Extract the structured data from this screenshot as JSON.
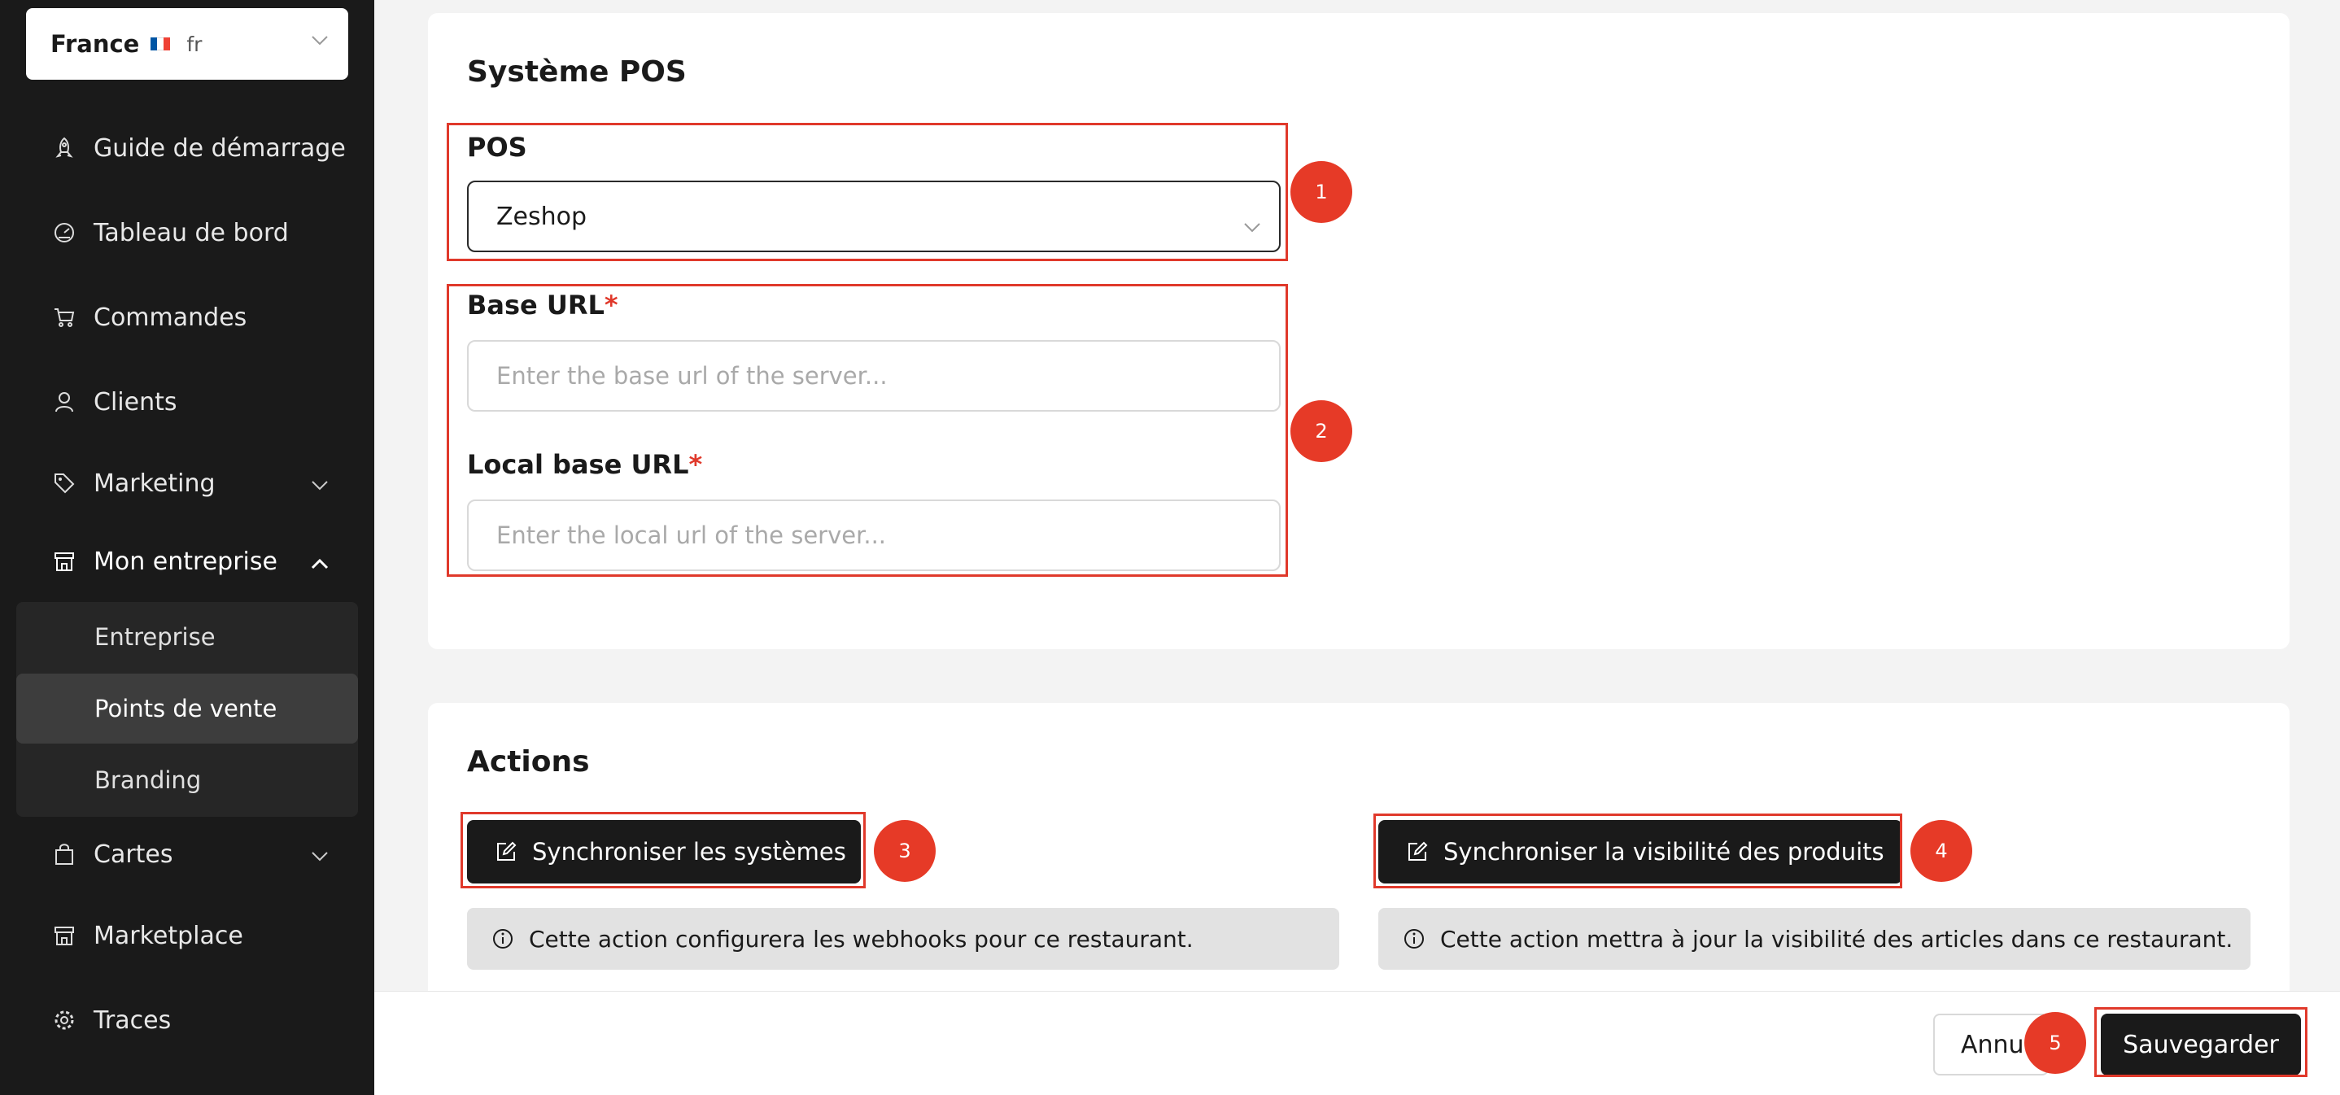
{
  "sidebar": {
    "country": {
      "name": "France",
      "flag_colors": [
        "#0055a4",
        "#ffffff",
        "#ef4135"
      ],
      "lang": "fr"
    },
    "items": [
      {
        "label": "Guide de démarrage",
        "icon": "rocket-icon"
      },
      {
        "label": "Tableau de bord",
        "icon": "dashboard-gauge-icon"
      },
      {
        "label": "Commandes",
        "icon": "cart-icon"
      },
      {
        "label": "Clients",
        "icon": "user-icon"
      },
      {
        "label": "Marketing",
        "icon": "tag-icon"
      },
      {
        "label": "Mon entreprise",
        "icon": "store-icon"
      },
      {
        "label": "Cartes",
        "icon": "bag-icon"
      },
      {
        "label": "Marketplace",
        "icon": "store-icon"
      },
      {
        "label": "Traces",
        "icon": "gear-icon"
      }
    ],
    "submenu": [
      {
        "label": "Entreprise"
      },
      {
        "label": "Points de vente",
        "active": true
      },
      {
        "label": "Branding"
      }
    ]
  },
  "pos_card": {
    "title": "Système POS",
    "pos_label": "POS",
    "pos_value": "Zeshop",
    "base_url_label": "Base URL",
    "base_url_placeholder": "Enter the base url of the server...",
    "local_url_label": "Local base URL",
    "local_url_placeholder": "Enter the local url of the server...",
    "required_mark": "*"
  },
  "actions_card": {
    "title": "Actions",
    "sync_systems_label": "Synchroniser les systèmes",
    "sync_systems_info": "Cette action configurera les webhooks pour ce restaurant.",
    "sync_visibility_label": "Synchroniser la visibilité des produits",
    "sync_visibility_info": "Cette action mettra à jour la visibilité des articles dans ce restaurant."
  },
  "footer": {
    "cancel_label": "Annu",
    "save_label": "Sauvegarder"
  },
  "annotations": {
    "badge_1": "1",
    "badge_2": "2",
    "badge_3": "3",
    "badge_4": "4",
    "badge_5": "5",
    "color": "#e63a27"
  }
}
